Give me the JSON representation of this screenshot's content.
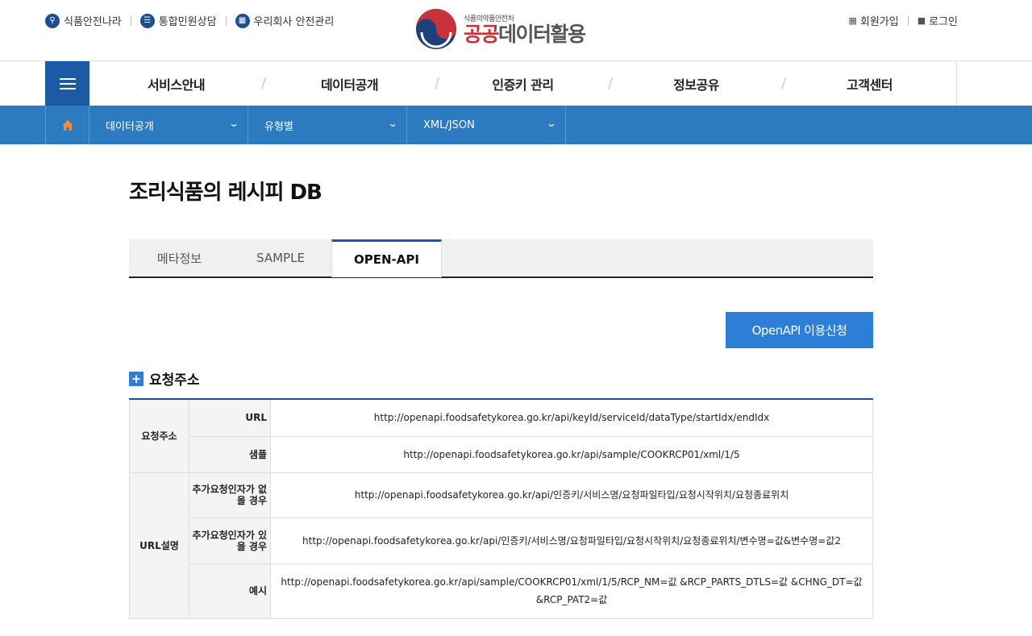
{
  "header": {
    "util_left": [
      {
        "label": "식품안전나라",
        "icon": "search-icon"
      },
      {
        "label": "통합민원상담",
        "icon": "document-icon"
      },
      {
        "label": "우리회사 안전관리",
        "icon": "building-icon"
      }
    ],
    "logo": {
      "sub": "식품의약품안전처",
      "main_red": "공공",
      "main_gray": "데이터활용"
    },
    "util_right": [
      {
        "label": "회원가입",
        "icon": "signup-icon"
      },
      {
        "label": "로그인",
        "icon": "lock-icon"
      }
    ]
  },
  "gnb": {
    "items": [
      "서비스안내",
      "데이터공개",
      "인증키 관리",
      "정보공유",
      "고객센터"
    ]
  },
  "breadcrumb": {
    "level1": "데이터공개",
    "level2": "유형별",
    "level3": "XML/JSON"
  },
  "page": {
    "title": "조리식품의 레시피 DB",
    "tabs": [
      "메타정보",
      "SAMPLE",
      "OPEN-API"
    ],
    "active_tab": "OPEN-API",
    "apply_button": "OpenAPI 이용신청",
    "section_title": "요청주소"
  },
  "request_table": {
    "group1": "요청주소",
    "group2": "URL설명",
    "rows": [
      {
        "key": "URL",
        "value": "http://openapi.foodsafetykorea.go.kr/api/keyId/serviceId/dataType/startIdx/endIdx"
      },
      {
        "key": "샘플",
        "value": "http://openapi.foodsafetykorea.go.kr/api/sample/COOKRCP01/xml/1/5"
      },
      {
        "key": "추가요청인자가 없을 경우",
        "value": "http://openapi.foodsafetykorea.go.kr/api/인증키/서비스명/요청파일타입/요청시작위치/요청종료위치"
      },
      {
        "key": "추가요청인자가 있을 경우",
        "value": "http://openapi.foodsafetykorea.go.kr/api/인증키/서비스명/요청파일타입/요청시작위치/요청종료위치/변수명=값&변수명=값2"
      },
      {
        "key": "예시",
        "value": "http://openapi.foodsafetykorea.go.kr/api/sample/COOKRCP01/xml/1/5/RCP_NM=값 &RCP_PARTS_DTLS=값 &CHNG_DT=값 &RCP_PAT2=값"
      }
    ]
  },
  "colors": {
    "primary": "#1d5aa6",
    "breadcrumb": "#2c7ac0",
    "button": "#2c7ed6",
    "logo_red": "#c8323b"
  }
}
